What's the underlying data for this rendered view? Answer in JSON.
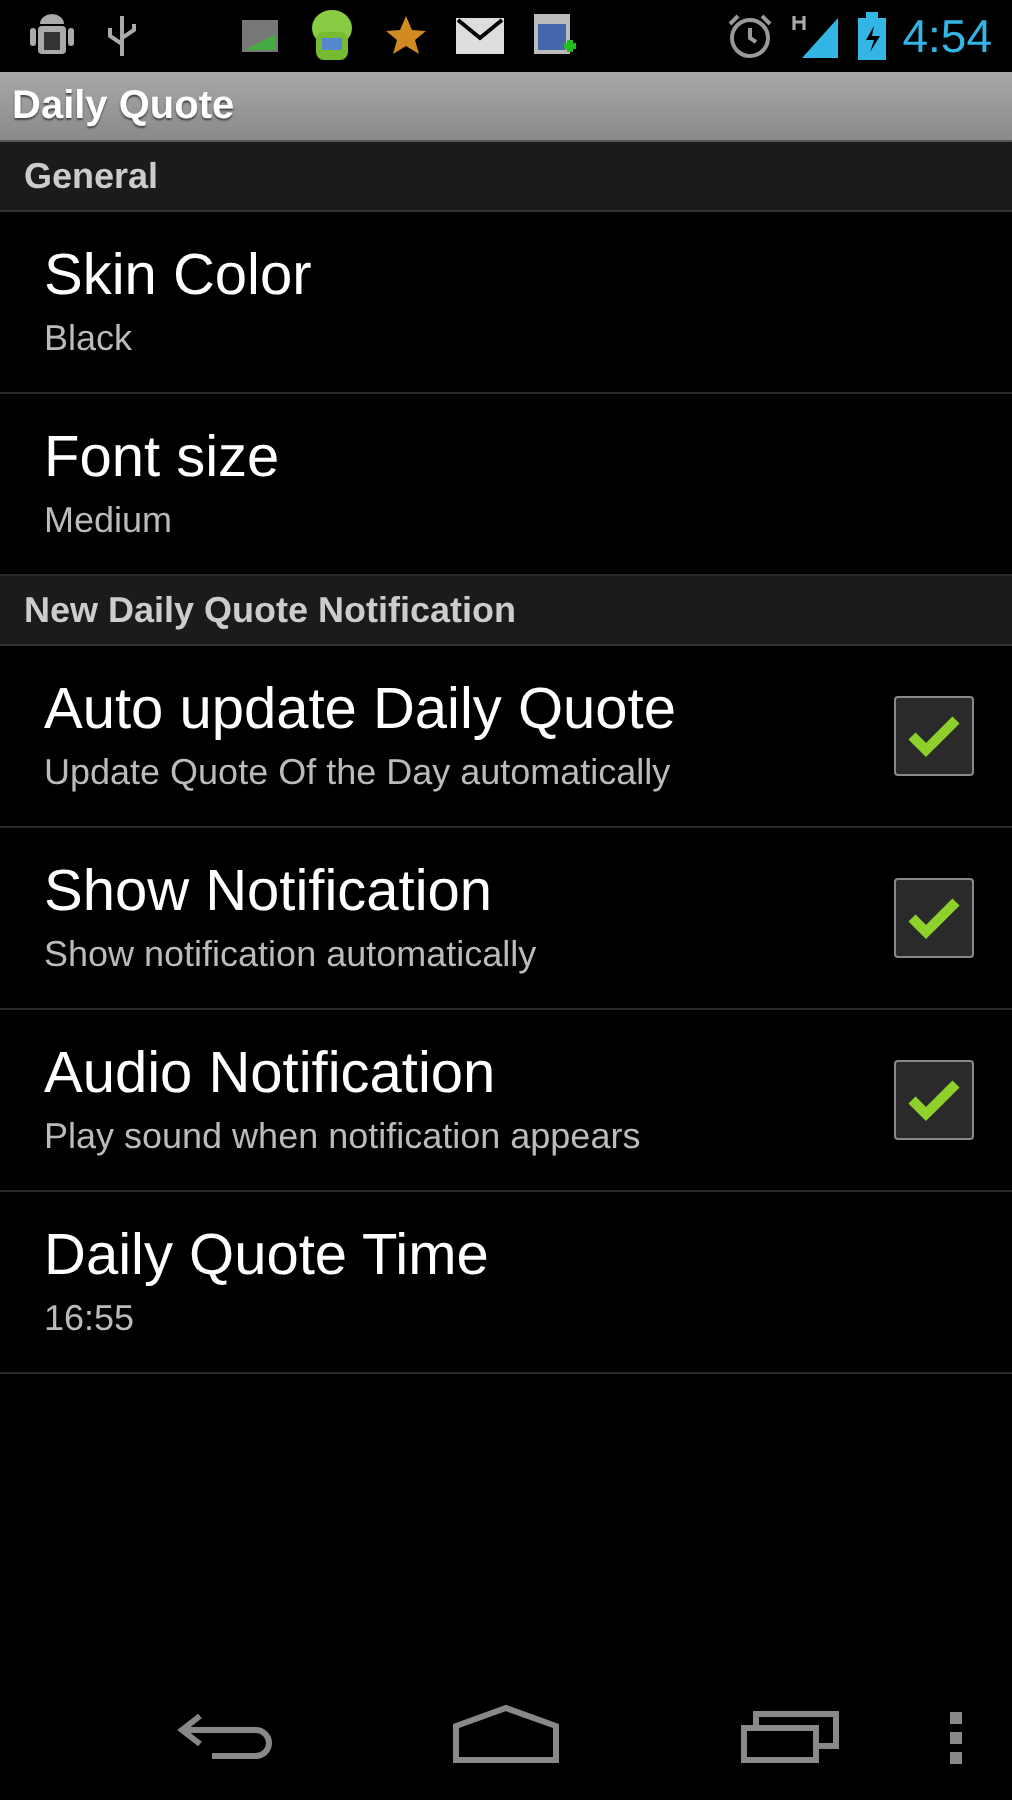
{
  "status_bar": {
    "time": "4:54"
  },
  "app_bar": {
    "title": "Daily Quote"
  },
  "sections": [
    {
      "header": "General",
      "items": [
        {
          "kind": "text",
          "title": "Skin Color",
          "summary": "Black"
        },
        {
          "kind": "text",
          "title": "Font size",
          "summary": "Medium"
        }
      ]
    },
    {
      "header": "New Daily Quote Notification",
      "items": [
        {
          "kind": "checkbox",
          "title": "Auto update Daily Quote",
          "summary": "Update Quote Of the Day automatically",
          "checked": true
        },
        {
          "kind": "checkbox",
          "title": "Show Notification",
          "summary": "Show notification automatically",
          "checked": true
        },
        {
          "kind": "checkbox",
          "title": "Audio Notification",
          "summary": "Play sound when notification appears",
          "checked": true
        },
        {
          "kind": "text",
          "title": "Daily Quote Time",
          "summary": "16:55"
        }
      ]
    }
  ]
}
